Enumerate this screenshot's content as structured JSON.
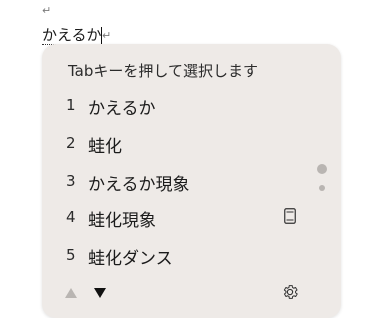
{
  "document": {
    "paragraph_mark_top": "↵",
    "composition_text": "かえるか",
    "paragraph_mark_inline": "↵"
  },
  "ime": {
    "hint": "Tabキーを押して選択します",
    "candidates": [
      {
        "num": "1",
        "text": "かえるか"
      },
      {
        "num": "2",
        "text": "蛙化"
      },
      {
        "num": "3",
        "text": "かえるか現象"
      },
      {
        "num": "4",
        "text": "蛙化現象",
        "icon": "dictionary-icon"
      },
      {
        "num": "5",
        "text": "蛙化ダンス"
      }
    ],
    "icons": {
      "prev": "triangle-up-icon",
      "next": "triangle-down-icon",
      "settings": "gear-icon"
    },
    "colors": {
      "panel_bg": "#eeeae7",
      "text": "#1b1b1b",
      "muted": "#b9b5b2"
    }
  }
}
